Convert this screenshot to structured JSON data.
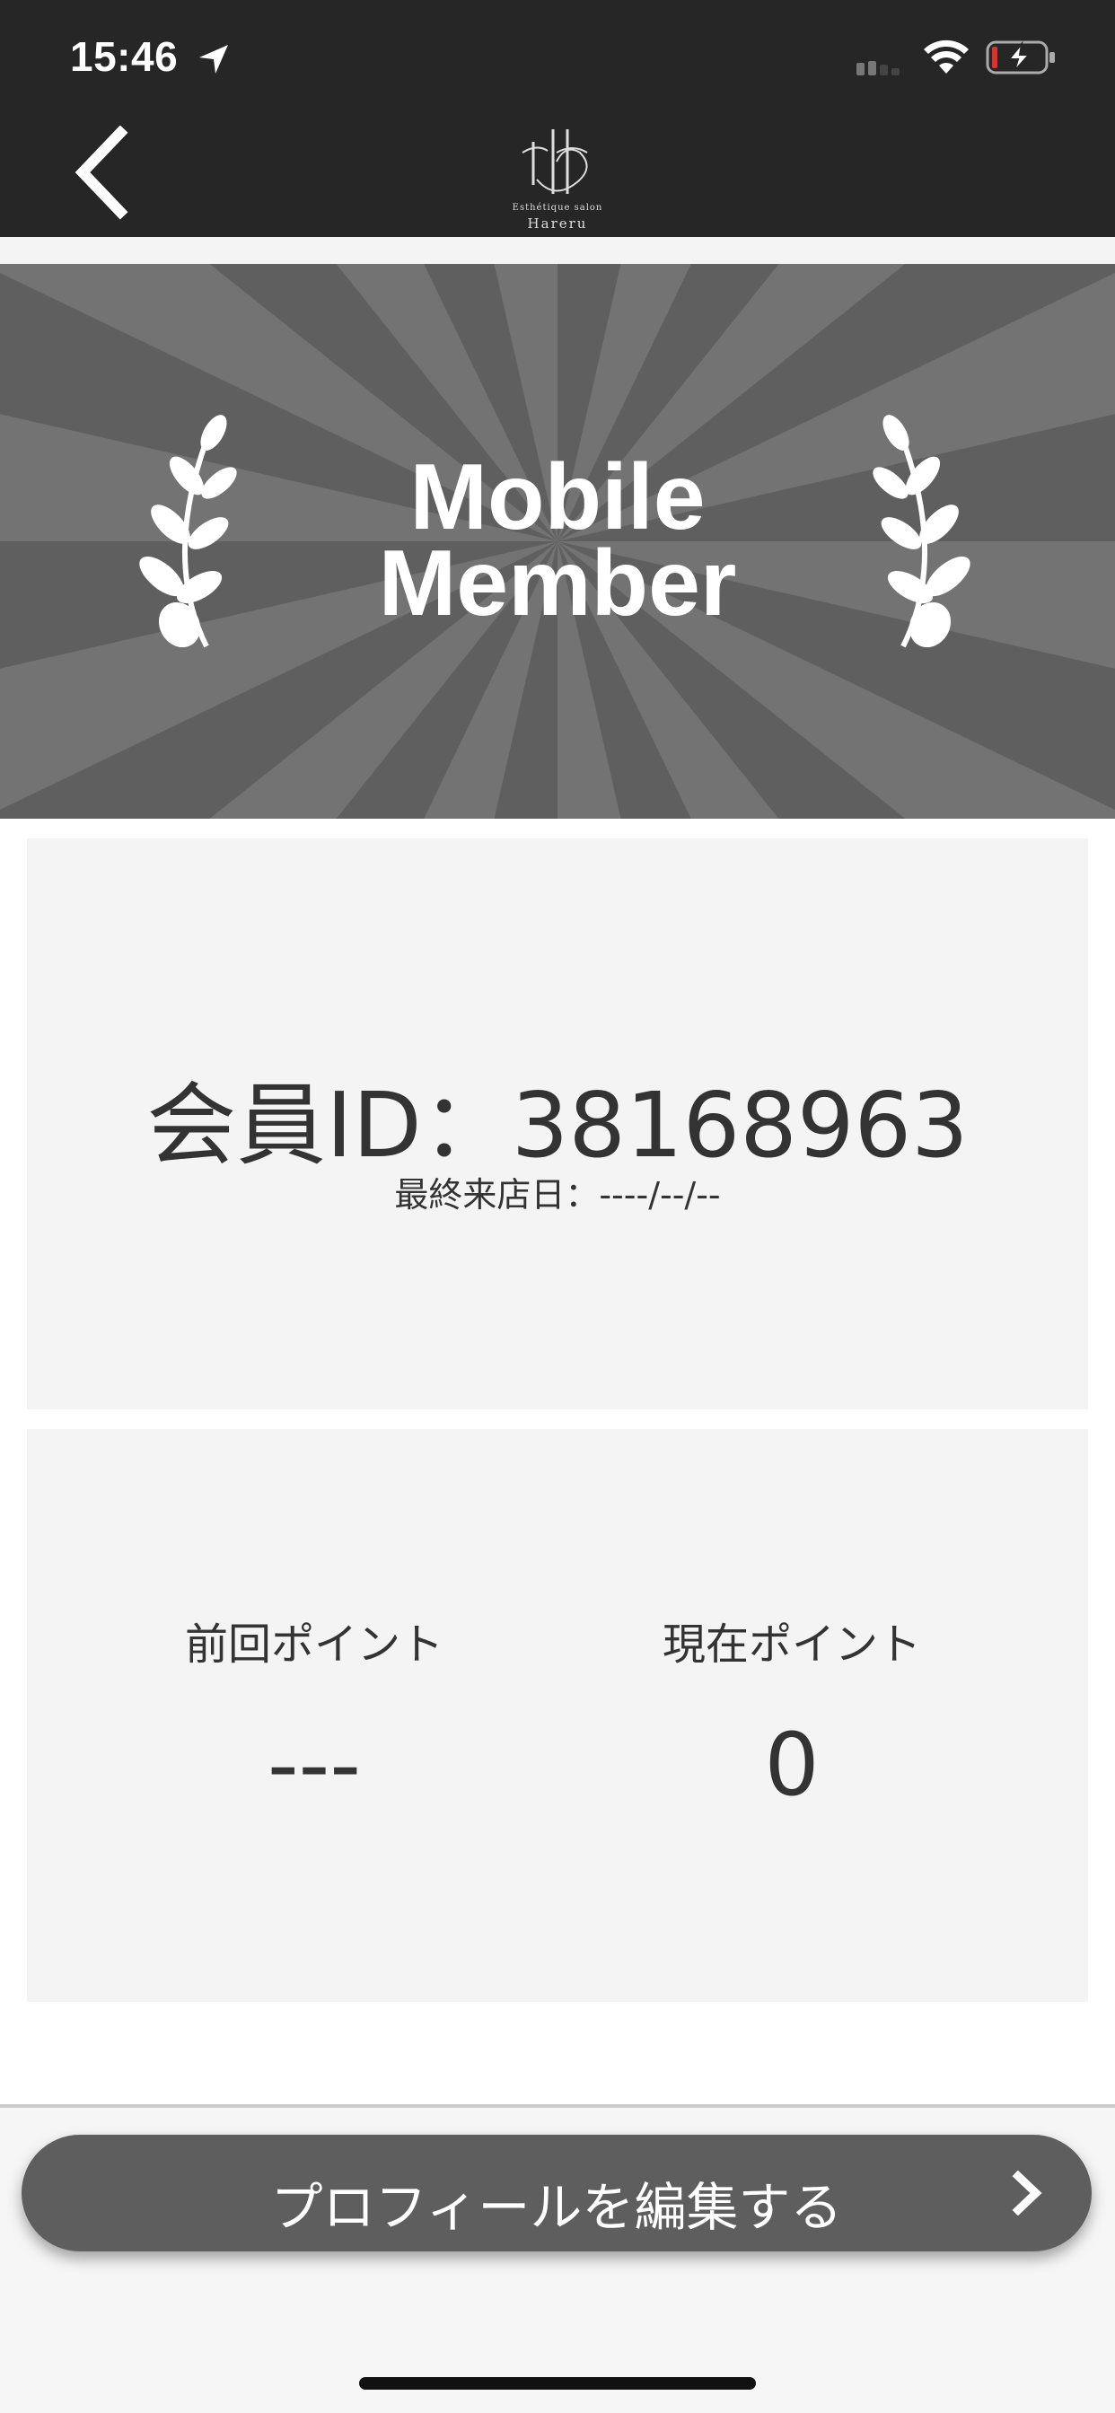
{
  "status_bar": {
    "time": "15:46",
    "icons": [
      "location-arrow-icon",
      "cellular-signal-icon",
      "wifi-icon",
      "battery-charging-icon"
    ]
  },
  "header": {
    "back_icon": "chevron-left-icon",
    "logo": {
      "subtitle": "Esthétique salon",
      "name": "Hareru"
    }
  },
  "banner": {
    "title_line1": "Mobile",
    "title_line2": "Member",
    "decoration": "laurel-icon"
  },
  "member_card": {
    "member_id_text": "会員ID：38168963",
    "last_visit_text": "最終来店日：----/--/--"
  },
  "points_card": {
    "previous": {
      "label": "前回ポイント",
      "value": "---"
    },
    "current": {
      "label": "現在ポイント",
      "value": "0"
    }
  },
  "footer": {
    "edit_profile_label": "プロフィールを編集する",
    "edit_profile_icon": "chevron-right-icon"
  },
  "colors": {
    "header_bg": "#262626",
    "banner_bg": "#5f5f5f",
    "banner_ray": "#737373",
    "card_bg": "#f4f4f4",
    "button_bg": "#5e5e5e"
  }
}
